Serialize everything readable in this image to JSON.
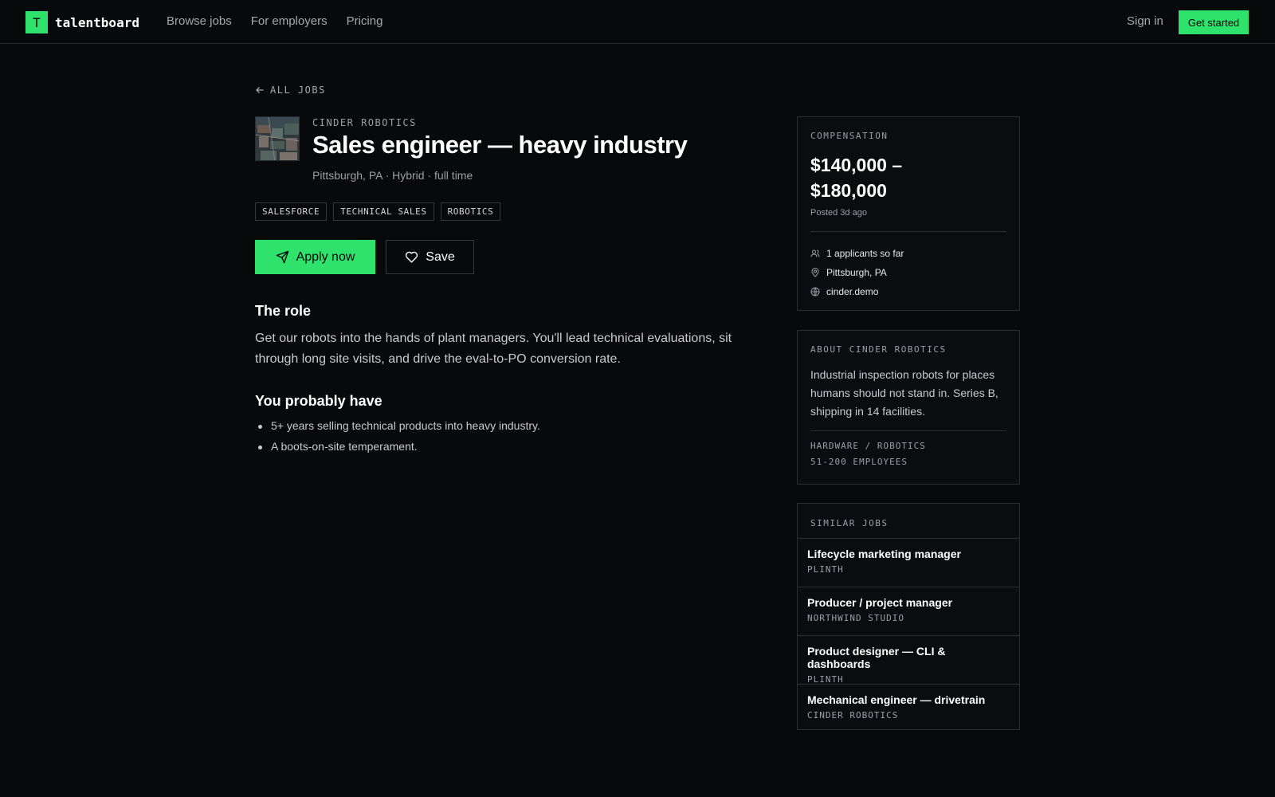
{
  "nav": {
    "logo_letter": "T",
    "logo_text": "talentboard",
    "links": [
      "Browse jobs",
      "For employers",
      "Pricing"
    ],
    "sign_in": "Sign in",
    "get_started": "Get started"
  },
  "job": {
    "back_label": "ALL JOBS",
    "company": "CINDER ROBOTICS",
    "title": "Sales engineer — heavy industry",
    "meta": "Pittsburgh, PA · Hybrid · full time",
    "tags": [
      "SALESFORCE",
      "TECHNICAL SALES",
      "ROBOTICS"
    ],
    "apply_label": "Apply now",
    "save_label": "Save",
    "role_heading": "The role",
    "role_text": "Get our robots into the hands of plant managers. You'll lead technical evaluations, sit through long site visits, and drive the eval-to-PO conversion rate.",
    "have_heading": "You probably have",
    "have_items": [
      "5+ years selling technical products into heavy industry.",
      "A boots-on-site temperament."
    ]
  },
  "compensation": {
    "kicker": "COMPENSATION",
    "range_line1": "$140,000 –",
    "range_line2": "$180,000",
    "posted": "Posted 3d ago",
    "applicants": "1 applicants so far",
    "location": "Pittsburgh, PA",
    "website": "cinder.demo"
  },
  "about": {
    "kicker": "ABOUT CINDER ROBOTICS",
    "text": "Industrial inspection robots for places humans should not stand in. Series B, shipping in 14 facilities.",
    "industry": "HARDWARE / ROBOTICS",
    "size": "51-200 EMPLOYEES"
  },
  "similar": {
    "kicker": "SIMILAR JOBS",
    "jobs": [
      {
        "title": "Lifecycle marketing manager",
        "company": "PLINTH"
      },
      {
        "title": "Producer / project manager",
        "company": "NORTHWIND STUDIO"
      },
      {
        "title": "Product designer — CLI & dashboards",
        "company": "PLINTH"
      },
      {
        "title": "Mechanical engineer — drivetrain",
        "company": "CINDER ROBOTICS"
      }
    ]
  },
  "colors": {
    "accent": "#2ee26b",
    "background": "#07090b",
    "border": "#2a2e33"
  }
}
